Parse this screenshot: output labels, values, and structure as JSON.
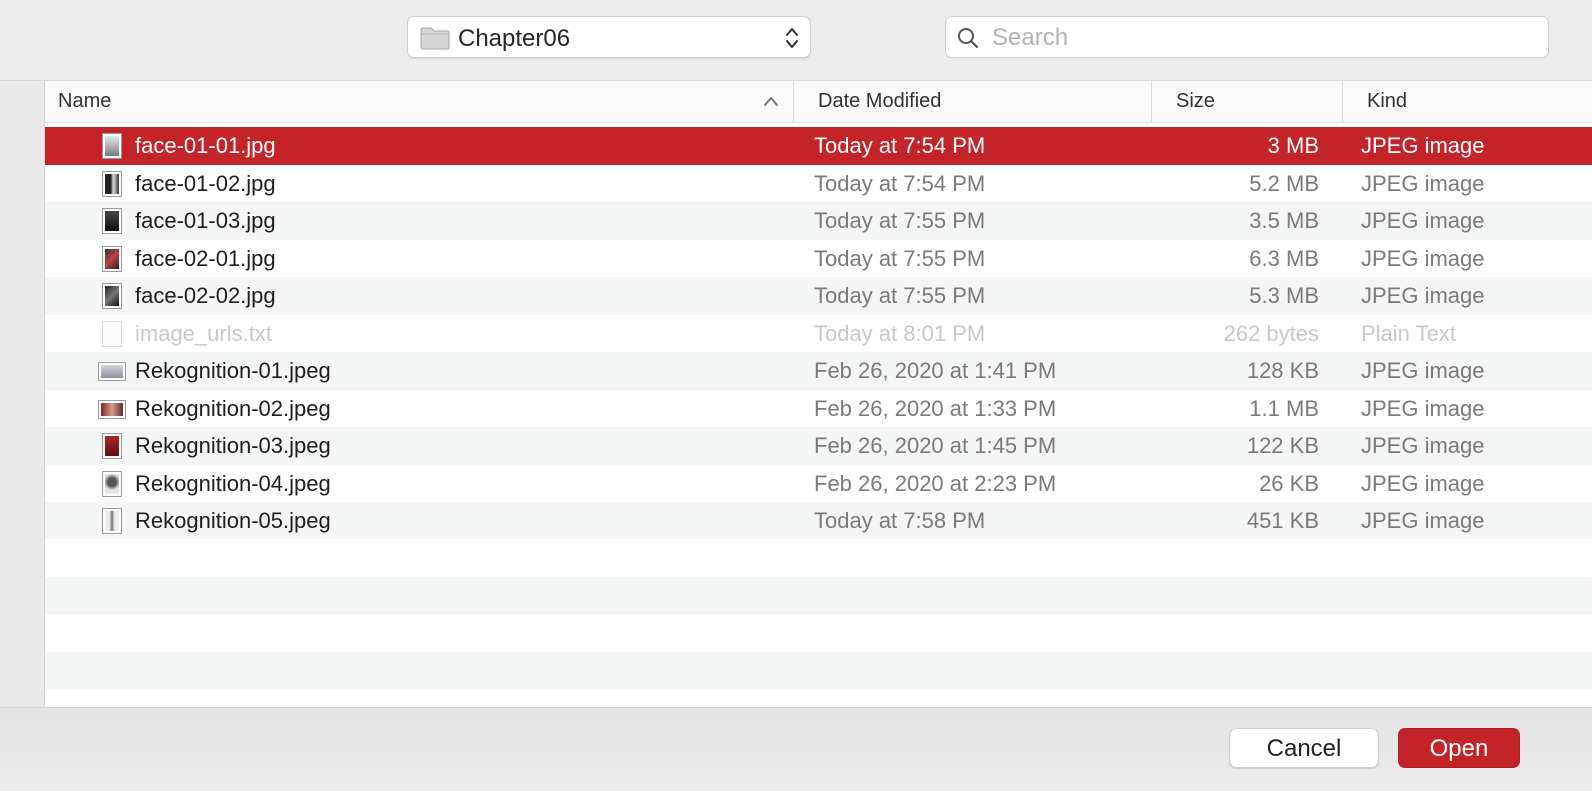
{
  "toolbar": {
    "folder_name": "Chapter06",
    "search_placeholder": "Search"
  },
  "columns": {
    "name": "Name",
    "date": "Date Modified",
    "size": "Size",
    "kind": "Kind"
  },
  "files": [
    {
      "name": "face-01-01.jpg",
      "date": "Today at 7:54 PM",
      "size": "3 MB",
      "kind": "JPEG image"
    },
    {
      "name": "face-01-02.jpg",
      "date": "Today at 7:54 PM",
      "size": "5.2 MB",
      "kind": "JPEG image"
    },
    {
      "name": "face-01-03.jpg",
      "date": "Today at 7:55 PM",
      "size": "3.5 MB",
      "kind": "JPEG image"
    },
    {
      "name": "face-02-01.jpg",
      "date": "Today at 7:55 PM",
      "size": "6.3 MB",
      "kind": "JPEG image"
    },
    {
      "name": "face-02-02.jpg",
      "date": "Today at 7:55 PM",
      "size": "5.3 MB",
      "kind": "JPEG image"
    },
    {
      "name": "image_urls.txt",
      "date": "Today at 8:01 PM",
      "size": "262 bytes",
      "kind": "Plain Text"
    },
    {
      "name": "Rekognition-01.jpeg",
      "date": "Feb 26, 2020 at 1:41 PM",
      "size": "128 KB",
      "kind": "JPEG image"
    },
    {
      "name": "Rekognition-02.jpeg",
      "date": "Feb 26, 2020 at 1:33 PM",
      "size": "1.1 MB",
      "kind": "JPEG image"
    },
    {
      "name": "Rekognition-03.jpeg",
      "date": "Feb 26, 2020 at 1:45 PM",
      "size": "122 KB",
      "kind": "JPEG image"
    },
    {
      "name": "Rekognition-04.jpeg",
      "date": "Feb 26, 2020 at 2:23 PM",
      "size": "26 KB",
      "kind": "JPEG image"
    },
    {
      "name": "Rekognition-05.jpeg",
      "date": "Today at 7:58 PM",
      "size": "451 KB",
      "kind": "JPEG image"
    }
  ],
  "buttons": {
    "cancel": "Cancel",
    "open": "Open"
  },
  "colors": {
    "selection": "#c4232a",
    "primary_button": "#c4232a"
  }
}
